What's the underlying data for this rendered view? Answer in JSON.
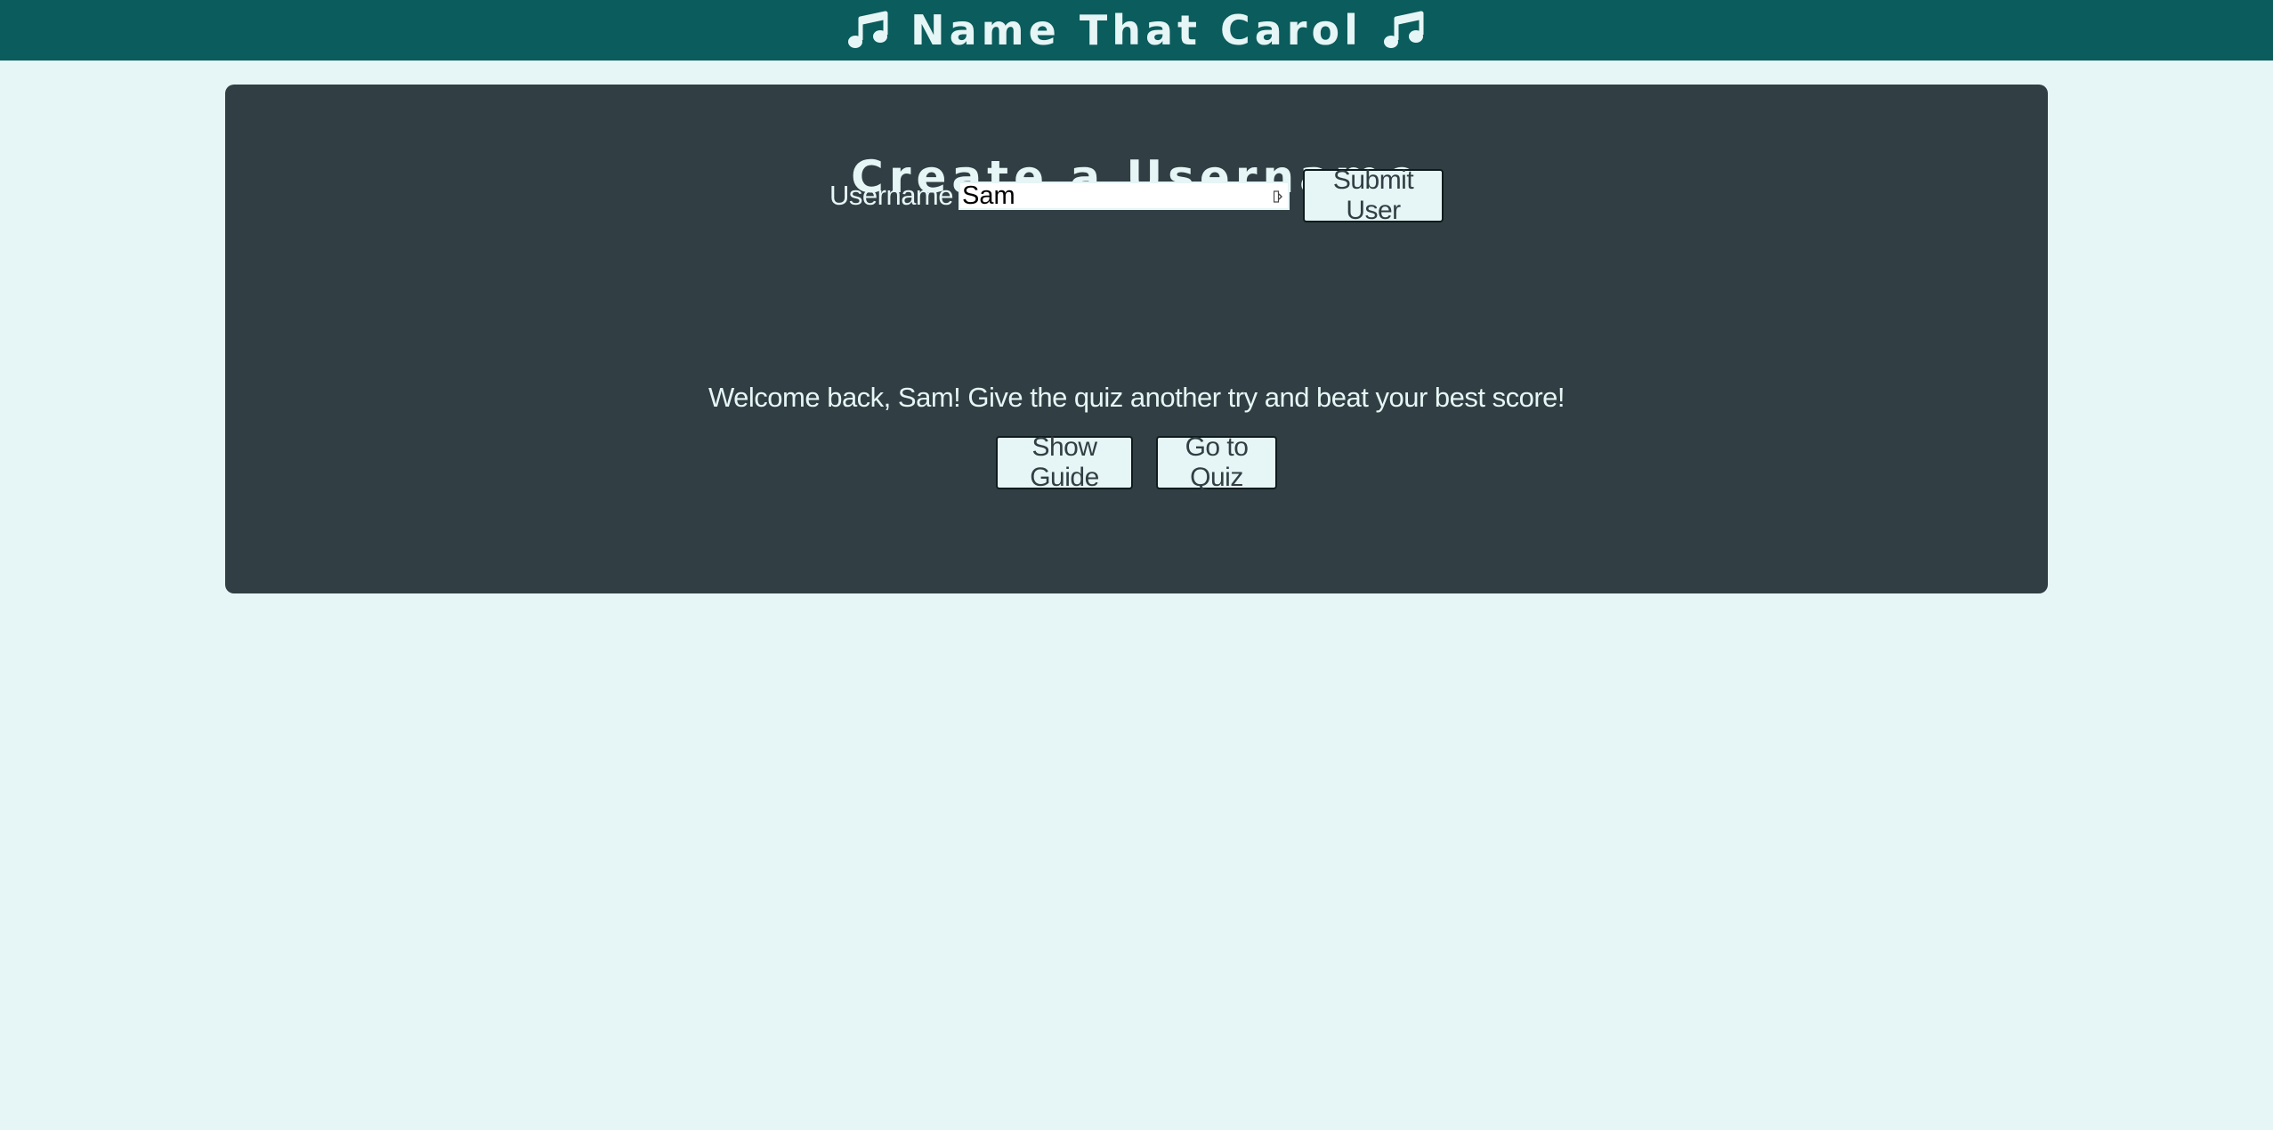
{
  "header": {
    "title": "Name That Carol",
    "left_icon": "music-note-icon",
    "right_icon": "music-note-icon",
    "background": "#0b5c5c",
    "text_color": "#e6f5f5"
  },
  "page": {
    "background": "#e6f5f5"
  },
  "panel": {
    "background": "#313f44",
    "title": "Create a Username",
    "form": {
      "label": "Username",
      "value": "Sam",
      "submit_label": "Submit User"
    },
    "welcome_message": "Welcome back, Sam! Give the quiz another try and beat your best score!",
    "actions": {
      "guide_label": "Show Guide",
      "quiz_label": "Go to Quiz"
    }
  }
}
